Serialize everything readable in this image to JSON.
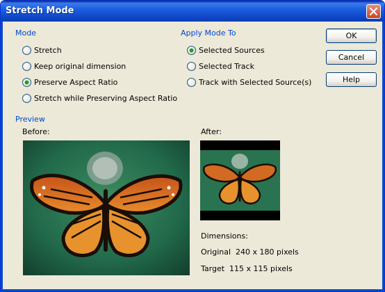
{
  "window": {
    "title": "Stretch Mode"
  },
  "mode": {
    "label": "Mode",
    "options": [
      {
        "label": "Stretch",
        "checked": false
      },
      {
        "label": "Keep original dimension",
        "checked": false
      },
      {
        "label": "Preserve Aspect Ratio",
        "checked": true
      },
      {
        "label": "Stretch while Preserving Aspect Ratio",
        "checked": false
      }
    ]
  },
  "apply": {
    "label": "Apply Mode To",
    "options": [
      {
        "label": "Selected Sources",
        "checked": true
      },
      {
        "label": "Selected Track",
        "checked": false
      },
      {
        "label": "Track with Selected Source(s)",
        "checked": false
      }
    ]
  },
  "buttons": {
    "ok": "OK",
    "cancel": "Cancel",
    "help": "Help"
  },
  "preview": {
    "label": "Preview",
    "before_label": "Before:",
    "after_label": "After:",
    "dimensions_label": "Dimensions:",
    "original": "Original  240 x 180 pixels",
    "target": "Target  115 x 115 pixels"
  },
  "colors": {
    "title_blue": "#0054E3",
    "group_label": "#0046D5",
    "dialog_bg": "#ECE9D8",
    "radio_check": "#21A121"
  }
}
